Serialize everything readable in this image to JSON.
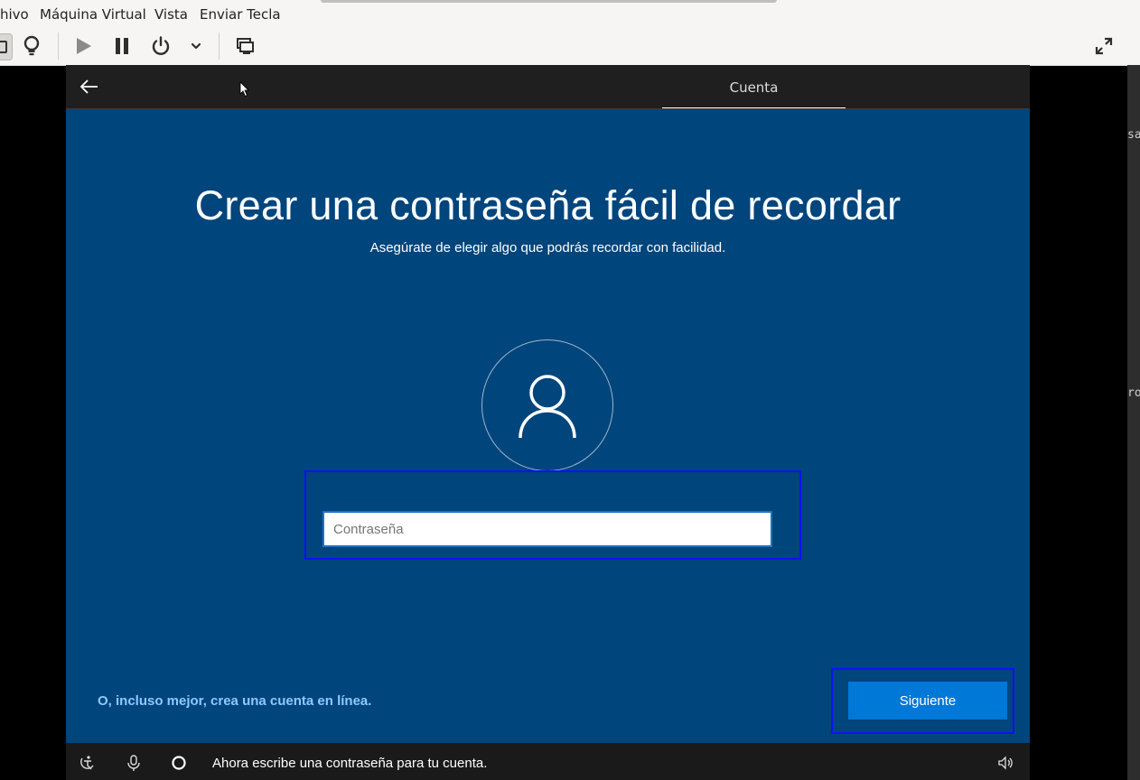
{
  "host": {
    "menu": [
      "hivo",
      "Máquina Virtual",
      "Vista",
      "Enviar Tecla"
    ],
    "side_fragments": [
      "sa",
      "ro"
    ]
  },
  "oobe": {
    "step_tab": "Cuenta",
    "title": "Crear una contraseña fácil de recordar",
    "subtitle": "Asegúrate de elegir algo que podrás recordar con facilidad.",
    "password_placeholder": "Contraseña",
    "online_link": "O, incluso mejor, crea una cuenta en línea.",
    "next_label": "Siguiente",
    "narrator_text": "Ahora escribe una contraseña para tu cuenta."
  },
  "colors": {
    "oobe_background": "#00457c",
    "primary_button": "#0078d7",
    "highlight_frame": "#1010ff",
    "link": "#8ec8ff"
  }
}
